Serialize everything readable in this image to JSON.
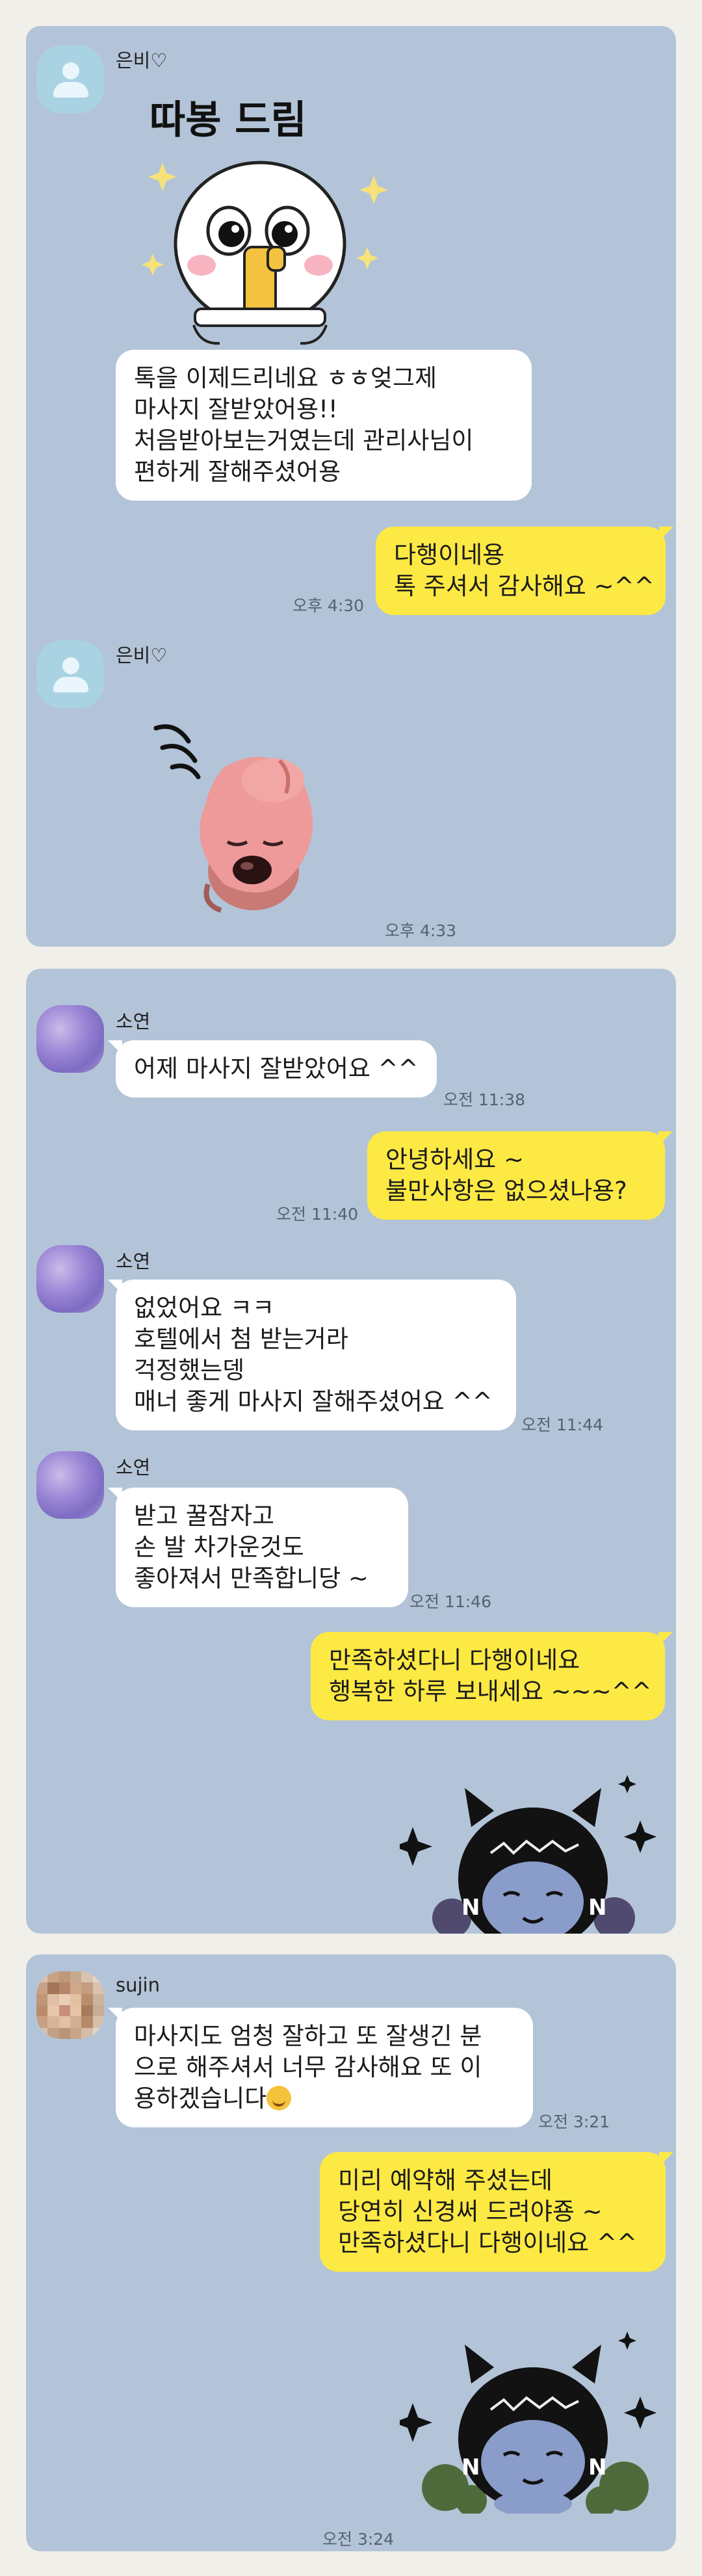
{
  "chat1": {
    "sender": "은비♡",
    "sticker_caption": "따봉 드림",
    "msg1": "톡을 이제드리네요 ㅎㅎ엊그제\n마사지 잘받았어용!!\n처음받아보는거였는데 관리사님이\n편하게 잘해주셨어용",
    "reply": "다행이네용\n톡 주셔서 감사해요 ~^^",
    "reply_time": "오후 4:30",
    "sender2": "은비♡",
    "sticker2_time": "오후 4:33"
  },
  "chat2": {
    "sender": "소연",
    "msg1": "어제 마사지 잘받았어요 ^^",
    "msg1_time": "오전 11:38",
    "reply1": "안녕하세요 ~\n불만사항은 없으셨나용?",
    "reply1_time": "오전 11:40",
    "sender2": "소연",
    "msg2": "없었어요 ㅋㅋ\n호텔에서 첨 받는거라\n걱정했는뎅\n매너 좋게 마사지 잘해주셨어요 ^^",
    "msg2_time": "오전 11:44",
    "sender3": "소연",
    "msg3": "받고 꿀잠자고\n손 발 차가운것도\n좋아져서 만족합니당 ~",
    "msg3_time": "오전 11:46",
    "reply2": "만족하셨다니 다행이네요\n행복한 하루 보내세요 ~~~^^"
  },
  "chat3": {
    "sender": "sujin",
    "msg1": "마사지도 엄청 잘하고 또 잘생긴 분\n으로 해주셔서 너무 감사해요 또 이\n용하겠습니다",
    "msg1_time": "오전 3:21",
    "reply1": "미리 예약해 주셨는데\n당연히 신경써 드려야죵 ~\n만족하셨다니 다행이네요 ^^",
    "sticker_time": "오전 3:24"
  },
  "colors": {
    "chat_bg": "#b3c4d8",
    "incoming_bubble": "#ffffff",
    "outgoing_bubble": "#fde944",
    "page_bg": "#f1efea"
  },
  "icons": {
    "default_avatar": "person-silhouette-icon",
    "sticker1": "thumbs-up-character-sticker",
    "sticker2": "pink-beaver-sticker",
    "sticker3": "dark-cat-character-sticker"
  }
}
